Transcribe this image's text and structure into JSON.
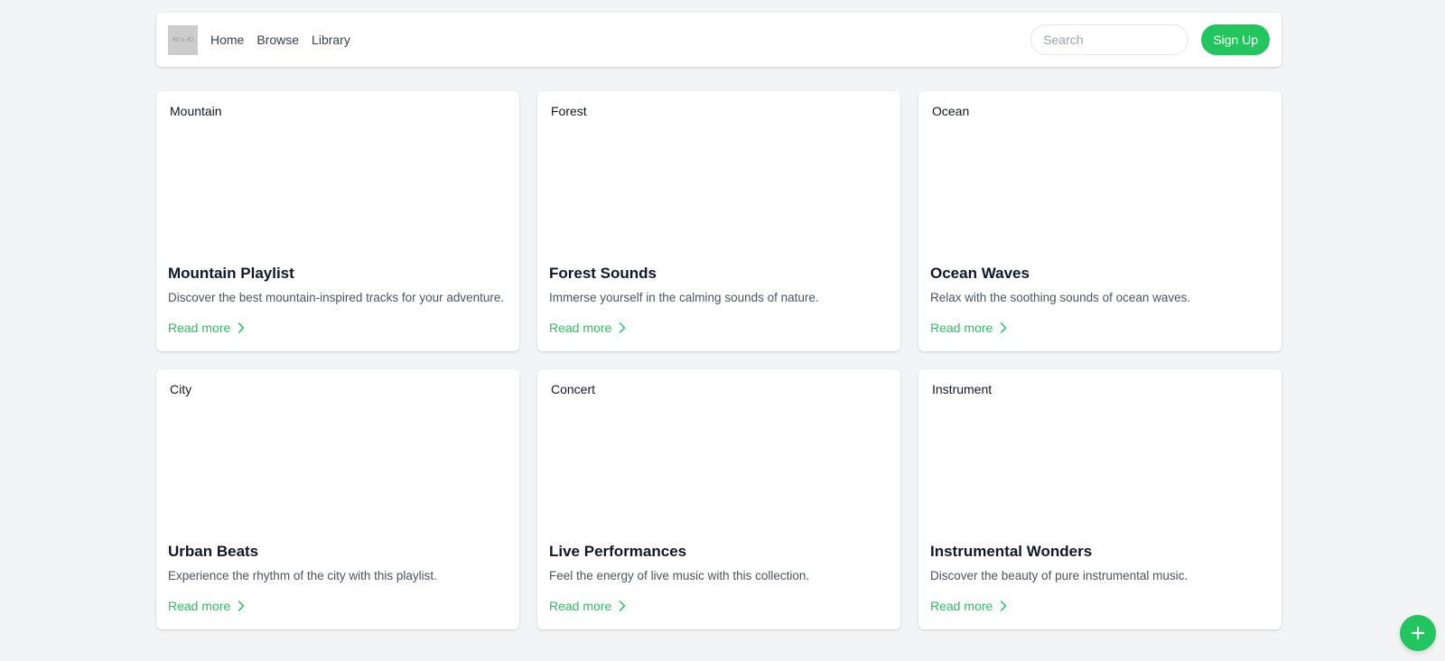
{
  "header": {
    "logo_text": "40 x 40",
    "nav": [
      {
        "label": "Home"
      },
      {
        "label": "Browse"
      },
      {
        "label": "Library"
      }
    ],
    "search_placeholder": "Search",
    "signup_label": "Sign Up"
  },
  "cards": [
    {
      "image_alt": "Mountain",
      "title": "Mountain Playlist",
      "description": "Discover the best mountain-inspired tracks for your adventure.",
      "link": "Read more"
    },
    {
      "image_alt": "Forest",
      "title": "Forest Sounds",
      "description": "Immerse yourself in the calming sounds of nature.",
      "link": "Read more"
    },
    {
      "image_alt": "Ocean",
      "title": "Ocean Waves",
      "description": "Relax with the soothing sounds of ocean waves.",
      "link": "Read more"
    },
    {
      "image_alt": "City",
      "title": "Urban Beats",
      "description": "Experience the rhythm of the city with this playlist.",
      "link": "Read more"
    },
    {
      "image_alt": "Concert",
      "title": "Live Performances",
      "description": "Feel the energy of live music with this collection.",
      "link": "Read more"
    },
    {
      "image_alt": "Instrument",
      "title": "Instrumental Wonders",
      "description": "Discover the beauty of pure instrumental music.",
      "link": "Read more"
    }
  ],
  "fab": {
    "icon": "plus-icon"
  },
  "colors": {
    "accent": "#22c55e",
    "background": "#f3f4f6"
  }
}
